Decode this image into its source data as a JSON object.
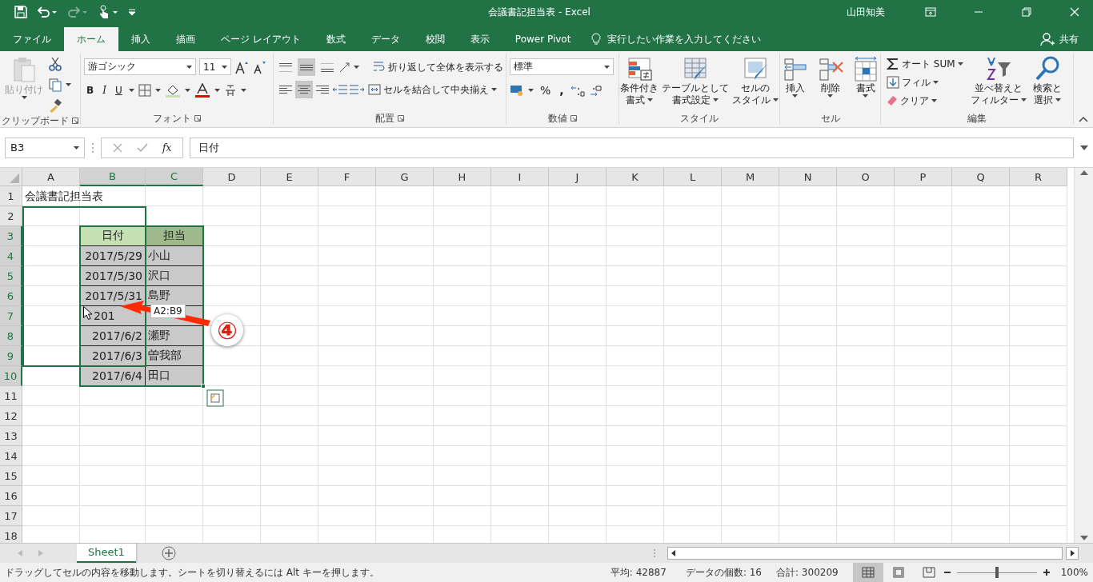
{
  "window": {
    "title": "会議書記担当表  -  Excel",
    "user": "山田知美"
  },
  "tabs": [
    {
      "label": "ファイル",
      "selected": false
    },
    {
      "label": "ホーム",
      "selected": true
    },
    {
      "label": "挿入",
      "selected": false
    },
    {
      "label": "描画",
      "selected": false
    },
    {
      "label": "ページ レイアウト",
      "selected": false
    },
    {
      "label": "数式",
      "selected": false
    },
    {
      "label": "データ",
      "selected": false
    },
    {
      "label": "校閲",
      "selected": false
    },
    {
      "label": "表示",
      "selected": false
    },
    {
      "label": "Power Pivot",
      "selected": false
    }
  ],
  "tell_me": {
    "placeholder": "実行したい作業を入力してください"
  },
  "share": "共有",
  "ribbon": {
    "clipboard": {
      "label": "クリップボード",
      "paste": "貼り付け"
    },
    "font": {
      "label": "フォント",
      "font": "游ゴシック",
      "size": "11",
      "bold": "B",
      "italic": "I",
      "underline": "U"
    },
    "alignment": {
      "label": "配置",
      "wrap": "折り返して全体を表示する",
      "merge": "セルを結合して中央揃え",
      "vertical": [
        {
          "selected": false
        },
        {
          "selected": true
        },
        {
          "selected": false
        }
      ],
      "horizontal": [
        {
          "selected": false
        },
        {
          "selected": true
        },
        {
          "selected": false
        }
      ]
    },
    "number": {
      "label": "数値",
      "format": "標準",
      "percent": "%",
      "comma": ","
    },
    "styles": {
      "label": "スタイル",
      "buttons": [
        [
          "条件付き",
          "書式"
        ],
        [
          "テーブルとして",
          "書式設定"
        ],
        [
          "セルの",
          "スタイル"
        ]
      ]
    },
    "cells": {
      "label": "セル",
      "buttons": [
        "挿入",
        "削除",
        "書式"
      ]
    },
    "editing": {
      "label": "編集",
      "autosum": "オート SUM",
      "fill": "フィル",
      "clear": "クリア",
      "sort": [
        "並べ替えと",
        "フィルター"
      ],
      "find": [
        "検索と",
        "選択"
      ]
    }
  },
  "formula_bar": {
    "name_box": "B3",
    "fx": "fx",
    "value": "日付"
  },
  "columns": [
    {
      "label": "A",
      "selected": false
    },
    {
      "label": "B",
      "selected": true
    },
    {
      "label": "C",
      "selected": true
    },
    {
      "label": "D",
      "selected": false
    },
    {
      "label": "E",
      "selected": false
    },
    {
      "label": "F",
      "selected": false
    },
    {
      "label": "G",
      "selected": false
    },
    {
      "label": "H",
      "selected": false
    },
    {
      "label": "I",
      "selected": false
    },
    {
      "label": "J",
      "selected": false
    },
    {
      "label": "K",
      "selected": false
    },
    {
      "label": "L",
      "selected": false
    },
    {
      "label": "M",
      "selected": false
    },
    {
      "label": "N",
      "selected": false
    },
    {
      "label": "O",
      "selected": false
    },
    {
      "label": "P",
      "selected": false
    },
    {
      "label": "Q",
      "selected": false
    },
    {
      "label": "R",
      "selected": false
    }
  ],
  "rows": [
    {
      "label": "1",
      "selected": false
    },
    {
      "label": "2",
      "selected": false
    },
    {
      "label": "3",
      "selected": true
    },
    {
      "label": "4",
      "selected": true
    },
    {
      "label": "5",
      "selected": true
    },
    {
      "label": "6",
      "selected": true
    },
    {
      "label": "7",
      "selected": true
    },
    {
      "label": "8",
      "selected": true
    },
    {
      "label": "9",
      "selected": true
    },
    {
      "label": "10",
      "selected": true
    },
    {
      "label": "11",
      "selected": false
    },
    {
      "label": "12",
      "selected": false
    },
    {
      "label": "13",
      "selected": false
    },
    {
      "label": "14",
      "selected": false
    },
    {
      "label": "15",
      "selected": false
    },
    {
      "label": "16",
      "selected": false
    },
    {
      "label": "17",
      "selected": false
    },
    {
      "label": "18",
      "selected": false
    }
  ],
  "sheet_title": "会議書記担当表",
  "table": {
    "header": [
      "日付",
      "担当"
    ],
    "rows": [
      {
        "date": "2017/5/29",
        "person": "小山"
      },
      {
        "date": "2017/5/30",
        "person": "沢口"
      },
      {
        "date": "2017/5/31",
        "person": "島野"
      },
      {
        "date": "201",
        "cut": true
      },
      {
        "date": "2017/6/2",
        "person": "瀬野"
      },
      {
        "date": "2017/6/3",
        "person": "曽我部"
      },
      {
        "date": "2017/6/4",
        "person": "田口"
      }
    ]
  },
  "drag_tooltip": "A2:B9",
  "step_marker": "④",
  "sheet_tabs": [
    {
      "label": "Sheet1",
      "selected": true
    }
  ],
  "status_bar": {
    "message": "ドラッグしてセルの内容を移動します。シートを切り替えるには Alt キーを押します。",
    "average": "平均: 42887",
    "count": "データの個数: 16",
    "sum": "合計: 300209",
    "views": [
      {
        "selected": true
      },
      {
        "selected": false
      },
      {
        "selected": false
      }
    ],
    "zoom": {
      "level": 0.5,
      "label": "100%"
    }
  }
}
